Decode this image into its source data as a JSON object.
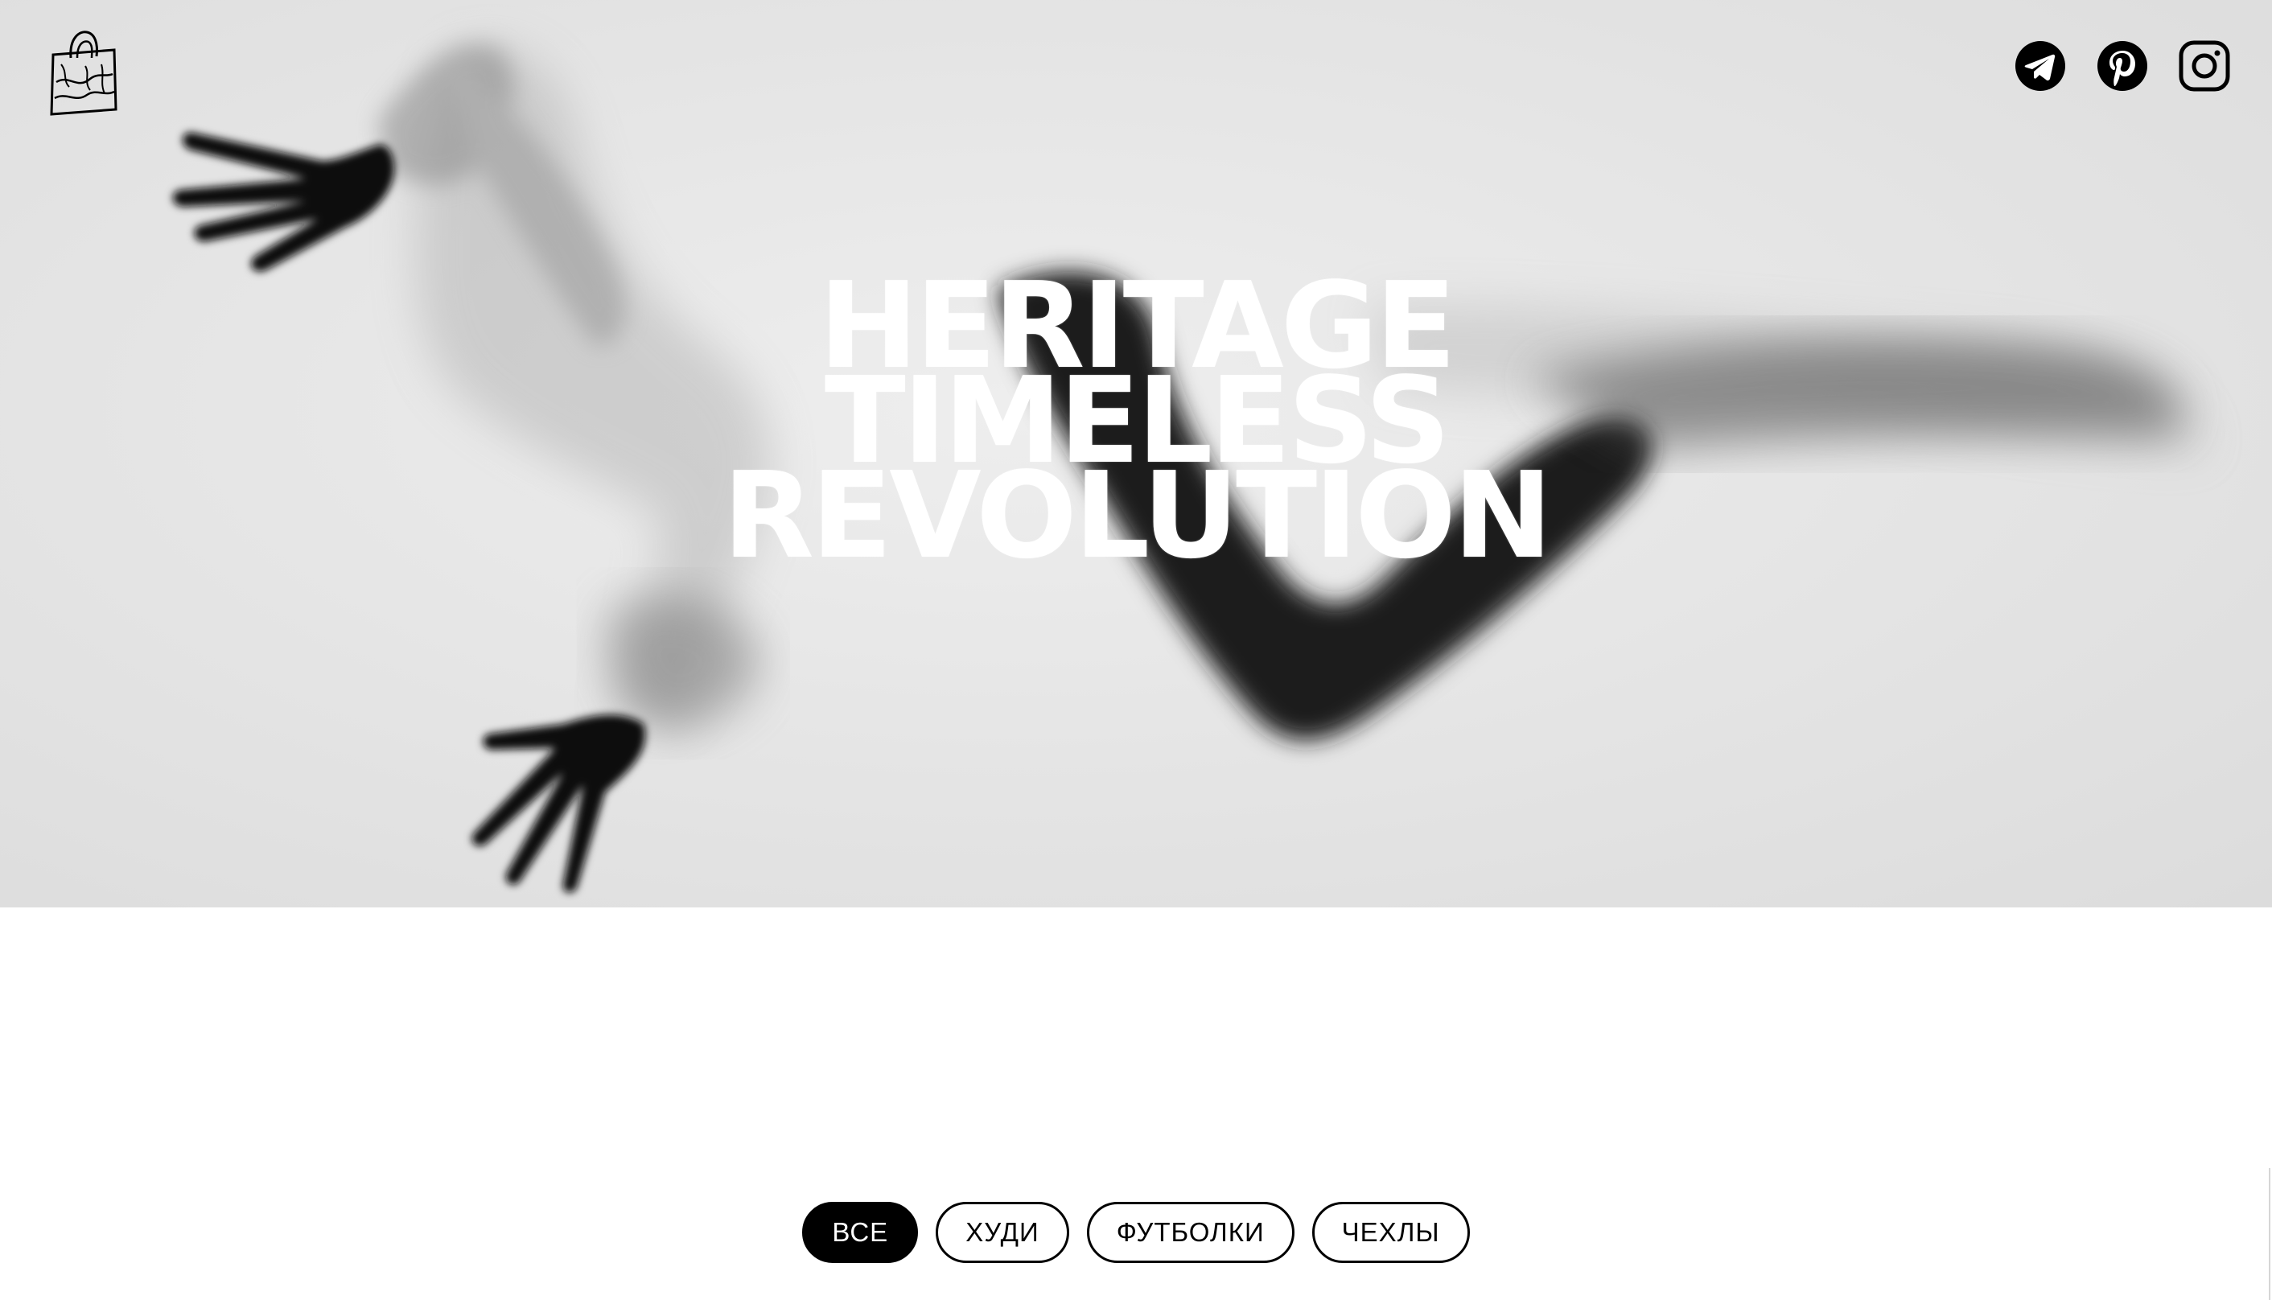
{
  "header": {
    "logo_icon": "shopping-bag-icon",
    "socials": [
      {
        "name": "telegram",
        "icon": "telegram-icon"
      },
      {
        "name": "pinterest",
        "icon": "pinterest-icon"
      },
      {
        "name": "instagram",
        "icon": "instagram-icon"
      }
    ]
  },
  "hero": {
    "lines": [
      "HERITAGE",
      "TIMELESS",
      "REVOLUTION"
    ],
    "background": "blurred silhouette behind frosted glass",
    "text_color": "#ffffff"
  },
  "filters": {
    "items": [
      {
        "label": "ВСЕ",
        "active": true
      },
      {
        "label": "ХУДИ",
        "active": false
      },
      {
        "label": "ФУТБОЛКИ",
        "active": false
      },
      {
        "label": "ЧЕХЛЫ",
        "active": false
      }
    ]
  },
  "colors": {
    "accent": "#000000",
    "background": "#ffffff",
    "hero_background": "#e4e4e4"
  }
}
